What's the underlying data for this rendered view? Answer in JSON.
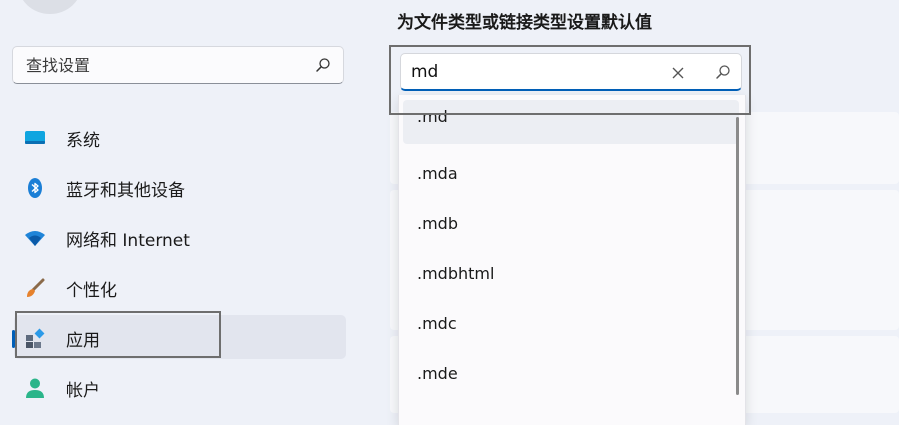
{
  "sidebar": {
    "search": {
      "placeholder": "查找设置",
      "icon": "search-icon"
    },
    "items": [
      {
        "label": "系统",
        "icon": "monitor-icon"
      },
      {
        "label": "蓝牙和其他设备",
        "icon": "bluetooth-icon"
      },
      {
        "label": "网络和 Internet",
        "icon": "wifi-icon"
      },
      {
        "label": "个性化",
        "icon": "brush-icon"
      },
      {
        "label": "应用",
        "icon": "apps-icon",
        "selected": true
      },
      {
        "label": "帐户",
        "icon": "person-icon"
      }
    ]
  },
  "main": {
    "heading": "为文件类型或链接类型设置默认值",
    "file_type_search": {
      "value": "md",
      "clear_icon": "close-icon",
      "search_icon": "search-icon"
    },
    "suggestions": [
      ".md",
      ".mda",
      ".mdb",
      ".mdbhtml",
      ".mdc",
      ".mde"
    ]
  },
  "colors": {
    "accent": "#005fb8",
    "background": "#eef1f8"
  }
}
